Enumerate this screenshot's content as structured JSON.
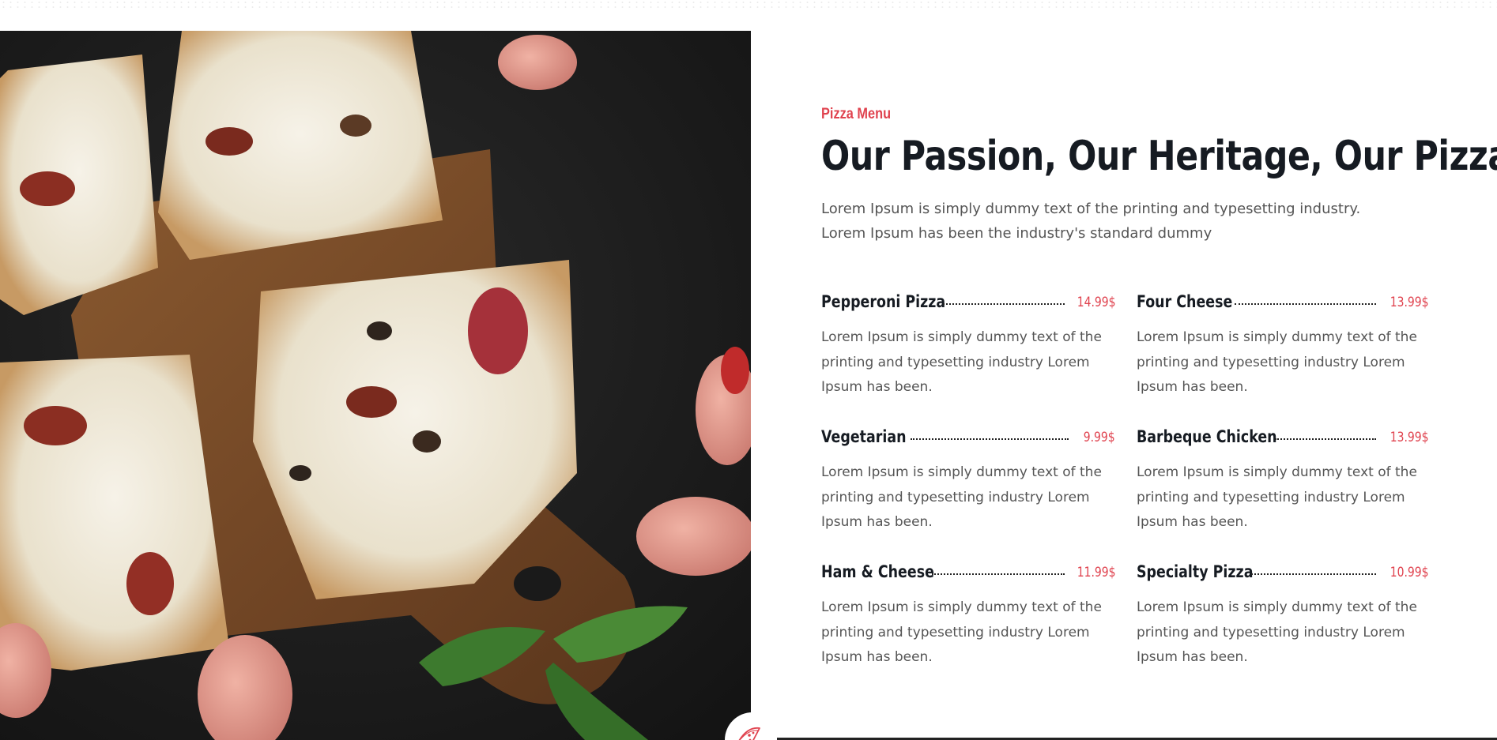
{
  "section": {
    "eyebrow": "Pizza Menu",
    "title": "Our Passion, Our Heritage, Our Pizzas",
    "intro_line1": "Lorem Ipsum is simply dummy text of the printing and typesetting industry.",
    "intro_line2": "Lorem Ipsum has been the industry's standard dummy"
  },
  "menu": [
    {
      "name": "Pepperoni Pizza",
      "price": "14.99$",
      "description": "Lorem Ipsum is simply dummy text of the printing and typesetting industry Lorem Ipsum has been."
    },
    {
      "name": "Four Cheese",
      "price": "13.99$",
      "description": "Lorem Ipsum is simply dummy text of the printing and typesetting industry Lorem Ipsum has been."
    },
    {
      "name": "Vegetarian",
      "price": "9.99$",
      "description": "Lorem Ipsum is simply dummy text of the printing and typesetting industry Lorem Ipsum has been."
    },
    {
      "name": "Barbeque Chicken",
      "price": "13.99$",
      "description": "Lorem Ipsum is simply dummy text of the printing and typesetting industry Lorem Ipsum has been."
    },
    {
      "name": "Ham & Cheese",
      "price": "11.99$",
      "description": "Lorem Ipsum is simply dummy text of the printing and typesetting industry Lorem Ipsum has been."
    },
    {
      "name": "Specialty Pizza",
      "price": "10.99$",
      "description": "Lorem Ipsum is simply dummy text of the printing and typesetting industry Lorem Ipsum has been."
    }
  ],
  "colors": {
    "accent": "#e0434f",
    "heading": "#161b22",
    "body_text": "#555555"
  },
  "icons": {
    "badge": "pizza-slice-icon"
  }
}
